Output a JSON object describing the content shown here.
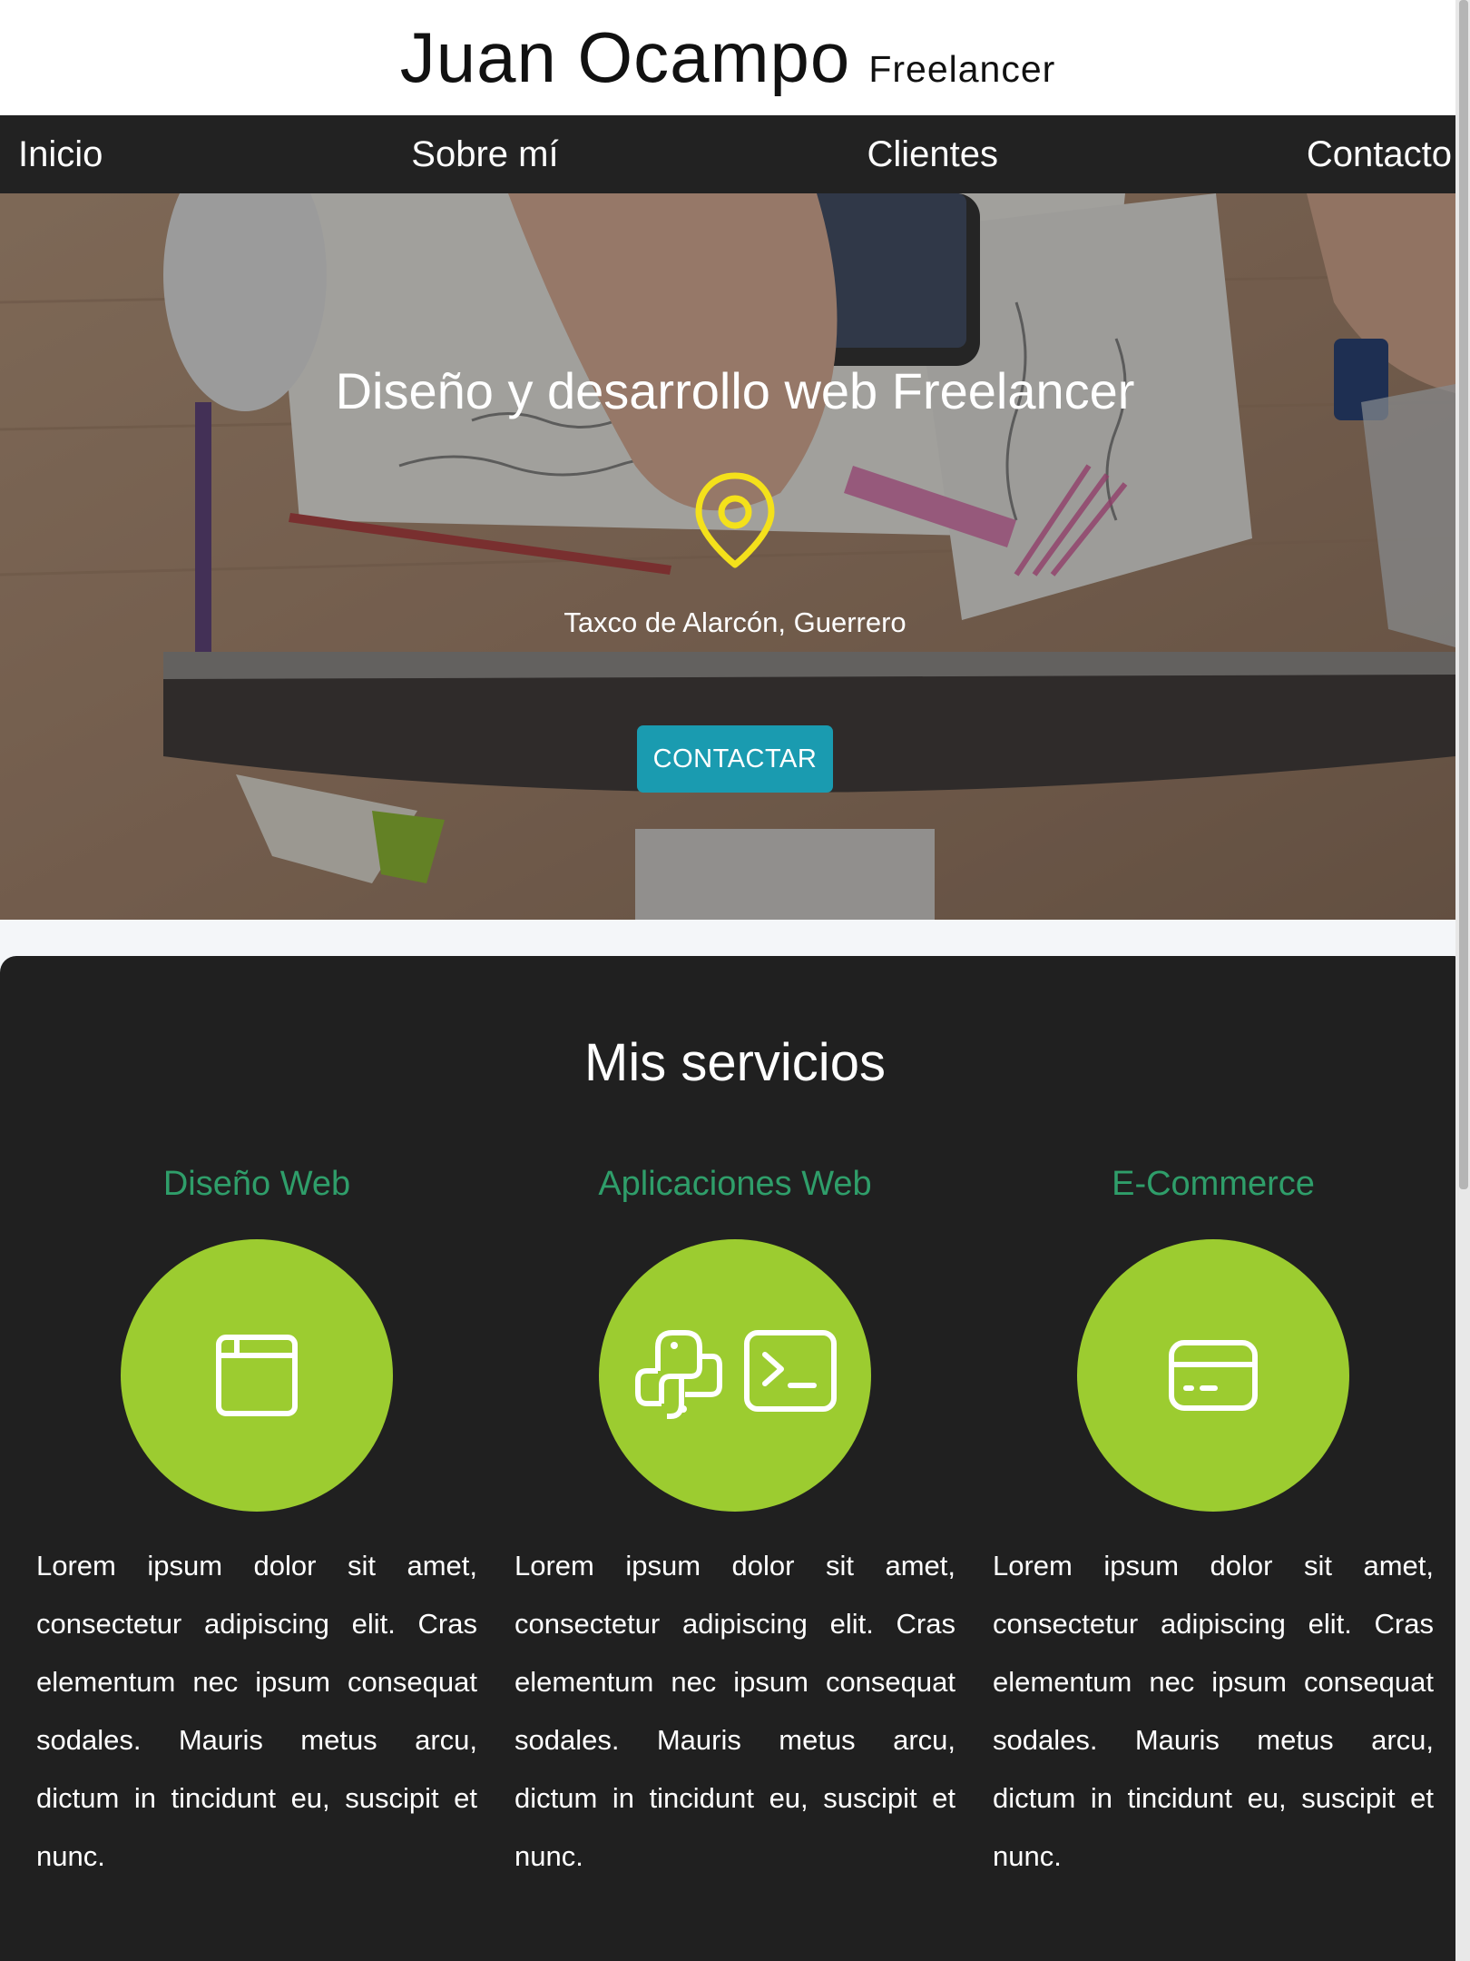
{
  "header": {
    "name": "Juan Ocampo",
    "subtitle": "Freelancer"
  },
  "nav": {
    "items": [
      "Inicio",
      "Sobre mí",
      "Clientes",
      "Contacto"
    ]
  },
  "hero": {
    "title": "Diseño y desarrollo web Freelancer",
    "location": "Taxco de Alarcón, Guerrero",
    "cta_label": "CONTACTAR",
    "icon": "map-pin-icon",
    "colors": {
      "pin": "#f4e11b",
      "cta": "#1a9bb0"
    }
  },
  "services": {
    "title": "Mis servicios",
    "items": [
      {
        "title": "Diseño Web",
        "icon": "browser-window-icon",
        "text": "Lorem ipsum dolor sit amet, consectetur adipiscing elit. Cras elementum nec ipsum consequat sodales. Mauris metus arcu, dictum in tincidunt eu, suscipit et nunc."
      },
      {
        "title": "Aplicaciones Web",
        "icon": "python-terminal-icon",
        "text": "Lorem ipsum dolor sit amet, consectetur adipiscing elit. Cras elementum nec ipsum consequat sodales. Mauris metus arcu, dictum in tincidunt eu, suscipit et nunc."
      },
      {
        "title": "E-Commerce",
        "icon": "credit-card-icon",
        "text": "Lorem ipsum dolor sit amet, consectetur adipiscing elit. Cras elementum nec ipsum consequat sodales. Mauris metus arcu, dictum in tincidunt eu, suscipit et nunc."
      }
    ],
    "colors": {
      "circle": "#9ccc30",
      "title": "#2f9e6a",
      "background": "#202020"
    }
  }
}
